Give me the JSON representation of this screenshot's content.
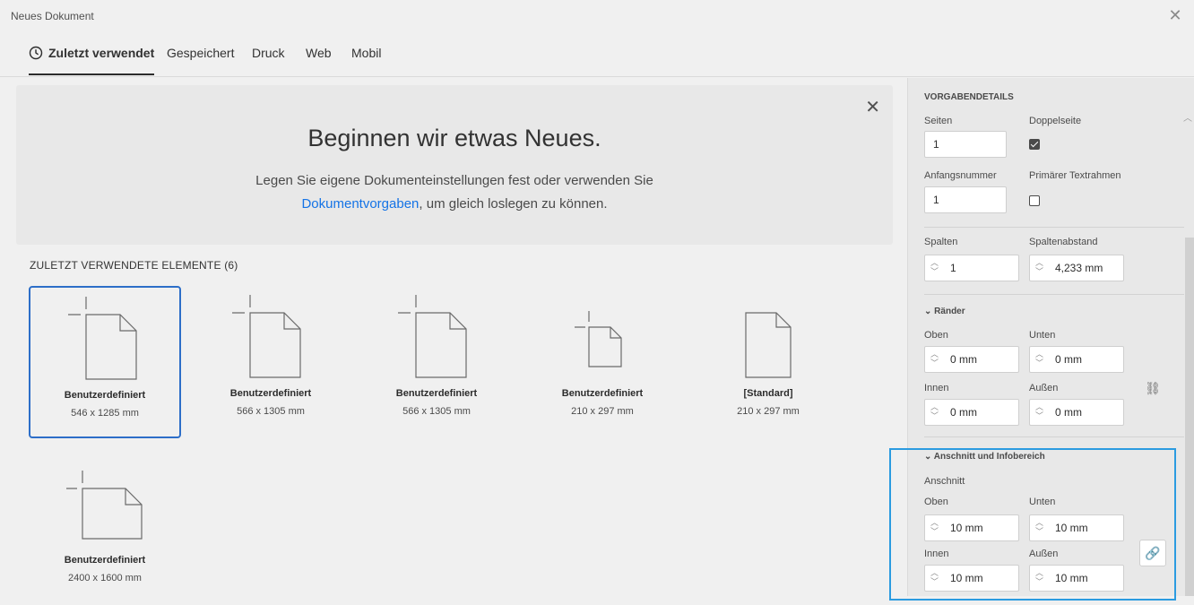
{
  "window": {
    "title": "Neues Dokument",
    "close_glyph": "✕"
  },
  "tabs": [
    {
      "label": "Zuletzt verwendet",
      "active": true,
      "icon": "clock-icon"
    },
    {
      "label": "Gespeichert"
    },
    {
      "label": "Druck"
    },
    {
      "label": "Web"
    },
    {
      "label": "Mobil"
    }
  ],
  "banner": {
    "headline": "Beginnen wir etwas Neues.",
    "line1": "Legen Sie eigene Dokumenteinstellungen fest oder verwenden Sie",
    "link": "Dokumentvorgaben",
    "line2_rest": ", um gleich loslegen zu können.",
    "close_glyph": "✕"
  },
  "recent": {
    "header": "ZULETZT VERWENDETE ELEMENTE",
    "count": "(6)",
    "items": [
      {
        "name": "Benutzerdefiniert",
        "size": "546 x 1285 mm",
        "selected": true
      },
      {
        "name": "Benutzerdefiniert",
        "size": "566 x 1305 mm"
      },
      {
        "name": "Benutzerdefiniert",
        "size": "566 x 1305 mm"
      },
      {
        "name": "Benutzerdefiniert",
        "size": "210 x 297 mm"
      },
      {
        "name": "[Standard]",
        "size": "210 x 297 mm"
      },
      {
        "name": "Benutzerdefiniert",
        "size": "2400 x 1600 mm"
      }
    ]
  },
  "side": {
    "section_title": "VORGABENDETAILS",
    "seiten_label": "Seiten",
    "seiten_value": "1",
    "doppelseite_label": "Doppelseite",
    "doppelseite_checked": true,
    "anfangsnummer_label": "Anfangsnummer",
    "anfangsnummer_value": "1",
    "primaer_label": "Primärer Textrahmen",
    "primaer_checked": false,
    "spalten_label": "Spalten",
    "spalten_value": "1",
    "spaltenabstand_label": "Spaltenabstand",
    "spaltenabstand_value": "4,233 mm",
    "raender_label": "Ränder",
    "raender": {
      "oben_label": "Oben",
      "oben_value": "0 mm",
      "unten_label": "Unten",
      "unten_value": "0 mm",
      "innen_label": "Innen",
      "innen_value": "0 mm",
      "aussen_label": "Außen",
      "aussen_value": "0 mm"
    },
    "anschnitt_section": "Anschnitt und Infobereich",
    "anschnitt_label": "Anschnitt",
    "anschnitt": {
      "oben_label": "Oben",
      "oben_value": "10 mm",
      "unten_label": "Unten",
      "unten_value": "10 mm",
      "innen_label": "Innen",
      "innen_value": "10 mm",
      "aussen_label": "Außen",
      "aussen_value": "10 mm"
    }
  },
  "colors": {
    "accent": "#1473e6",
    "selection": "#2d6ec8",
    "focus": "#2b9be0"
  }
}
